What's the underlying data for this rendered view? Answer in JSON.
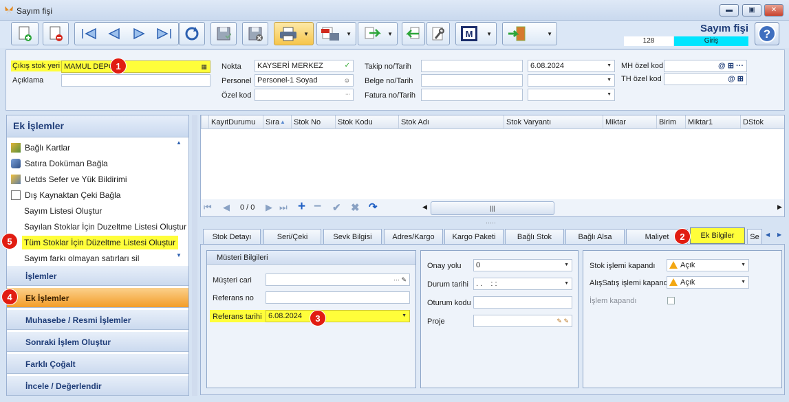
{
  "window": {
    "title": "Sayım fişi",
    "min": "▬",
    "max": "▣",
    "close": "✕"
  },
  "doc": {
    "name": "Sayım fişi",
    "number": "128",
    "type": "Giriş"
  },
  "header": {
    "cikis_label": "Çıkış stok yeri",
    "cikis_value": "MAMUL DEPO",
    "aciklama_label": "Açıklama",
    "aciklama_value": "",
    "nokta_label": "Nokta",
    "nokta_value": "KAYSERİ MERKEZ",
    "personel_label": "Personel",
    "personel_value": "Personel-1 Soyad",
    "ozelkod_label": "Özel kod",
    "ozelkod_value": "",
    "takip_label": "Takip no/Tarih",
    "takip_value": "",
    "takip_date": "6.08.2024",
    "belge_label": "Belge no/Tarih",
    "belge_value": "",
    "fatura_label": "Fatura no/Tarih",
    "fatura_value": "",
    "mh_label": "MH özel kod",
    "th_label": "TH özel kod"
  },
  "left_panel": {
    "title": "Ek İşlemler",
    "items": [
      "Bağlı Kartlar",
      "Satıra Doküman Bağla",
      "Uetds Sefer ve Yük Bildirimi",
      "Dış Kaynaktan Çeki Bağla",
      "Sayım Listesi Oluştur",
      "Sayılan Stoklar İçin Duzeltme Listesi Oluştur",
      "Tüm Stoklar İçin Düzeltme Listesi Oluştur",
      "Sayım farkı olmayan satırları sil"
    ],
    "sections": [
      "İşlemler",
      "Ek İşlemler",
      "Muhasebe / Resmi İşlemler",
      "Sonraki İşlem Oluştur",
      "Farklı Çoğalt",
      "İncele / Değerlendir"
    ]
  },
  "grid": {
    "columns": [
      "KayıtDurumu",
      "Sıra",
      "Stok No",
      "Stok Kodu",
      "Stok Adı",
      "Stok Varyantı",
      "Miktar",
      "Birim",
      "Miktar1",
      "DStok"
    ],
    "page": "0 / 0",
    "scroll_grip": "|||"
  },
  "tabs": [
    "Stok Detayı",
    "Seri/Çeki",
    "Sevk Bilgisi",
    "Adres/Kargo",
    "Kargo Paketi",
    "Bağlı Stok",
    "Bağlı Alsa",
    "Maliyet",
    "Ek Bilgiler",
    "Se"
  ],
  "ek_bilgiler": {
    "group_title": "Müsteri Bilgileri",
    "musteri_cari_label": "Müşteri cari",
    "musteri_cari_value": "",
    "referans_no_label": "Referans no",
    "referans_no_value": "",
    "referans_tarihi_label": "Referans tarihi",
    "referans_tarihi_value": "6.08.2024",
    "onay_yolu_label": "Onay yolu",
    "onay_yolu_value": "0",
    "durum_tarihi_label": "Durum tarihi",
    "durum_tarihi_value": ". .    : :",
    "oturum_kodu_label": "Oturum kodu",
    "oturum_kodu_value": "",
    "proje_label": "Proje",
    "proje_value": "",
    "stok_kapandi_label": "Stok işlemi kapandı",
    "stok_kapandi_value": "Açık",
    "alissatis_label": "AlışSatış işlemi kapandı",
    "alissatis_value": "Açık",
    "islem_kapandi_label": "İşlem kapandı"
  },
  "badges": [
    "1",
    "2",
    "3",
    "4",
    "5"
  ]
}
